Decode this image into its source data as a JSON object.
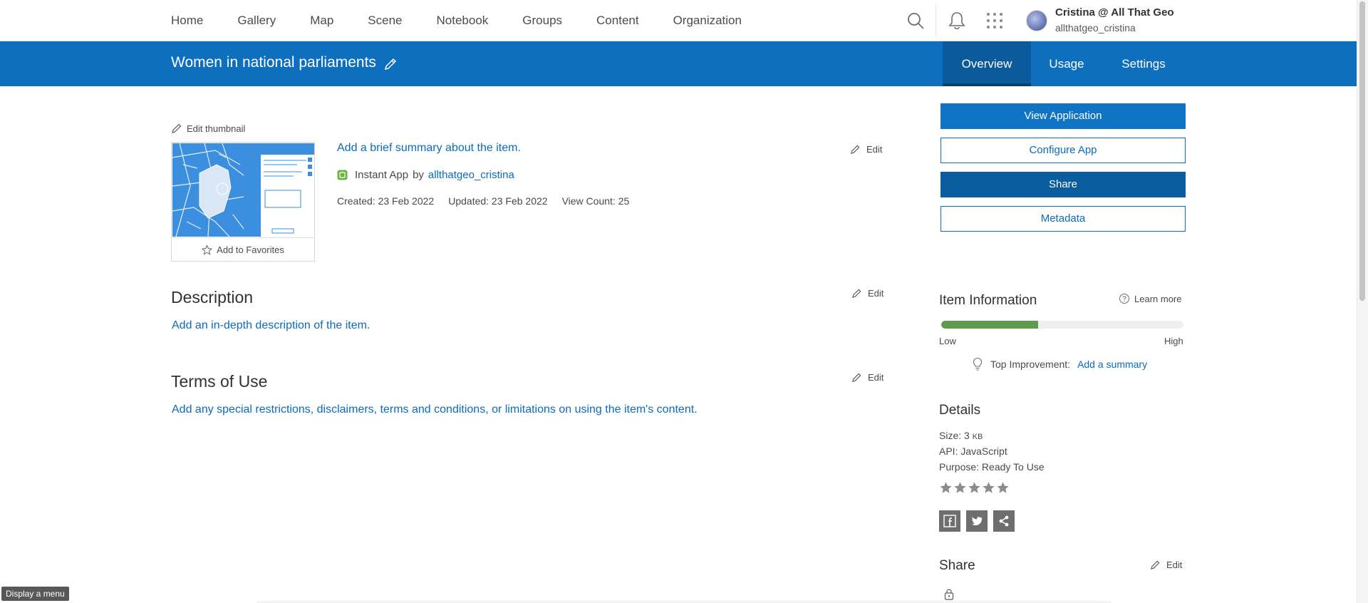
{
  "nav": {
    "items": [
      {
        "label": "Home"
      },
      {
        "label": "Gallery"
      },
      {
        "label": "Map"
      },
      {
        "label": "Scene"
      },
      {
        "label": "Notebook"
      },
      {
        "label": "Groups"
      },
      {
        "label": "Content"
      },
      {
        "label": "Organization"
      }
    ],
    "icons": [
      "search-icon",
      "bell-icon",
      "apps-grid-icon"
    ],
    "user": {
      "name": "Cristina @ All That Geo",
      "username": "allthatgeo_cristina"
    }
  },
  "titlebar": {
    "title": "Women in national parliaments",
    "tabs": [
      {
        "label": "Overview",
        "active": true
      },
      {
        "label": "Usage",
        "active": false
      },
      {
        "label": "Settings",
        "active": false
      }
    ]
  },
  "item": {
    "edit_thumbnail": "Edit thumbnail",
    "add_favorites": "Add to Favorites",
    "summary_placeholder": "Add a brief summary about the item.",
    "type": "Instant App",
    "by": "by",
    "owner": "allthatgeo_cristina",
    "created": "Created: 23 Feb 2022",
    "updated": "Updated: 23 Feb 2022",
    "views": "View Count: 25",
    "edit_label": "Edit"
  },
  "description": {
    "heading": "Description",
    "placeholder": "Add an in-depth description of the item.",
    "edit_label": "Edit"
  },
  "terms": {
    "heading": "Terms of Use",
    "placeholder": "Add any special restrictions, disclaimers, terms and conditions, or limitations on using the item's content.",
    "edit_label": "Edit"
  },
  "actions": {
    "view_application": "View Application",
    "configure_app": "Configure App",
    "share": "Share",
    "metadata": "Metadata"
  },
  "item_information": {
    "heading": "Item Information",
    "learn_more": "Learn more",
    "score_fraction": 0.4,
    "low": "Low",
    "high": "High",
    "top_improvement_label": "Top Improvement:",
    "top_improvement_link": "Add a summary"
  },
  "details": {
    "heading": "Details",
    "size_label": "Size: 3",
    "size_unit": "KB",
    "api": "API: JavaScript",
    "purpose": "Purpose: Ready To Use",
    "rating": 0,
    "rating_max": 5,
    "social": [
      "facebook-icon",
      "twitter-icon",
      "share-icon"
    ]
  },
  "share_section": {
    "heading": "Share",
    "edit_label": "Edit"
  },
  "tooltip": "Display a menu",
  "colors": {
    "brand_blue": "#0f6fbf",
    "link_blue": "#0b6bbf",
    "score_green": "#5f9a4e"
  }
}
